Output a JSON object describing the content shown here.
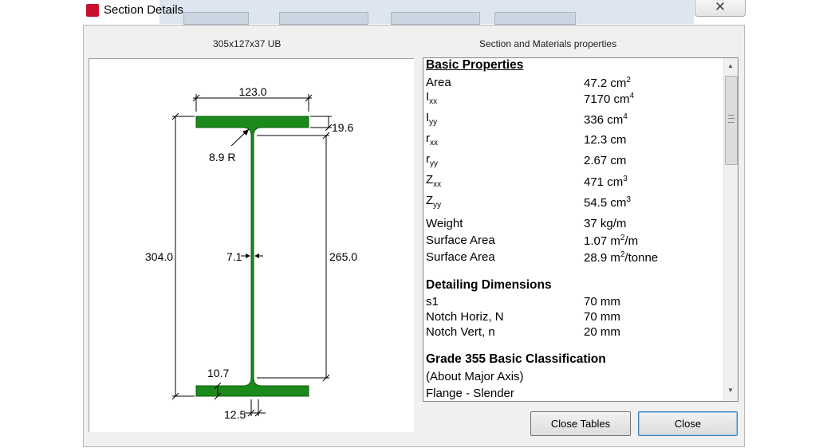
{
  "window": {
    "title": "Section Details",
    "close_glyph": "✕"
  },
  "section_name": "305x127x37 UB",
  "table_heading": "Section and Materials properties",
  "colors": {
    "section_fill": "#1b8a1b",
    "section_stroke": "#0b5a0b"
  },
  "drawing": {
    "flange_width": "123.0",
    "flange_thickness": "19.6",
    "root_radius": "8.9 R",
    "overall_depth": "304.0",
    "web_thickness": "7.1",
    "depth_between_fillets": "265.0",
    "bottom_flange_thickness": "10.7",
    "web_half": "12.5"
  },
  "basic_properties": {
    "heading": "Basic Properties",
    "rows": [
      {
        "name": "Area",
        "sub": "",
        "value": "47.2 cm",
        "sup": "2",
        "unit_tail": ""
      },
      {
        "name": "I",
        "sub": "xx",
        "value": "7170 cm",
        "sup": "4",
        "unit_tail": ""
      },
      {
        "name": "I",
        "sub": "yy",
        "value": "336 cm",
        "sup": "4",
        "unit_tail": ""
      },
      {
        "name": "r",
        "sub": "xx",
        "value": "12.3 cm",
        "sup": "",
        "unit_tail": ""
      },
      {
        "name": "r",
        "sub": "yy",
        "value": "2.67 cm",
        "sup": "",
        "unit_tail": ""
      },
      {
        "name": "Z",
        "sub": "xx",
        "value": "471 cm",
        "sup": "3",
        "unit_tail": ""
      },
      {
        "name": "Z",
        "sub": "yy",
        "value": "54.5 cm",
        "sup": "3",
        "unit_tail": ""
      },
      {
        "name": "Weight",
        "sub": "",
        "value": "37 kg/m",
        "sup": "",
        "unit_tail": ""
      },
      {
        "name": "Surface Area",
        "sub": "",
        "value": "1.07  m",
        "sup": "2",
        "unit_tail": "/m"
      },
      {
        "name": "Surface Area",
        "sub": "",
        "value": "28.9  m",
        "sup": "2",
        "unit_tail": "/tonne"
      }
    ]
  },
  "detailing": {
    "heading": "Detailing Dimensions",
    "rows": [
      {
        "name": "s1",
        "value": "70 mm"
      },
      {
        "name": "Notch Horiz, N",
        "value": "70 mm"
      },
      {
        "name": "Notch Vert, n",
        "value": "20 mm"
      }
    ]
  },
  "classification": {
    "heading": "Grade 355 Basic Classification",
    "subheading": "(About Major Axis)",
    "rows": [
      {
        "name": "Flange - Slender"
      }
    ]
  },
  "buttons": {
    "close_tables": "Close Tables",
    "close": "Close"
  }
}
